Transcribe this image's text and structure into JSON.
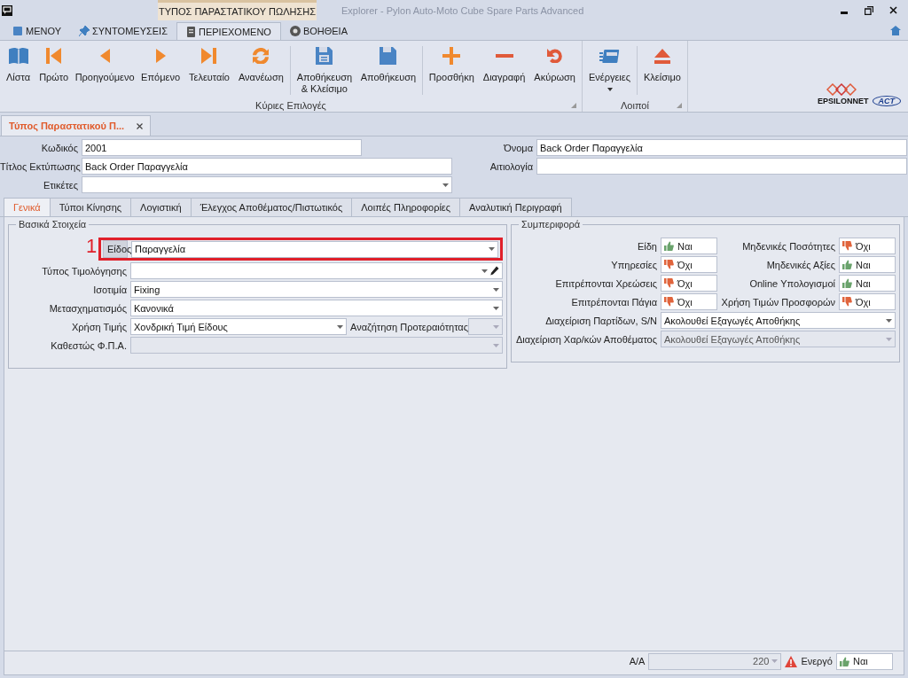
{
  "window": {
    "context_tab": "ΤΥΠΟΣ ΠΑΡΑΣΤΑΤΙΚΟΥ ΠΩΛΗΣΗΣ",
    "title": "Explorer - Pylon Auto-Moto Cube Spare Parts Advanced"
  },
  "ribbon_tabs": [
    {
      "label": "ΜΕΝΟΥ",
      "selected": false
    },
    {
      "label": "ΣΥΝΤΟΜΕΥΣΕΙΣ",
      "selected": false
    },
    {
      "label": "ΠΕΡΙΕΧΟΜΕΝΟ",
      "selected": true
    },
    {
      "label": "ΒΟΗΘΕΙΑ",
      "selected": false
    }
  ],
  "ribbon_groups": [
    {
      "label": "Κύριες Επιλογές",
      "sets": [
        [
          {
            "label": "Λίστα"
          },
          {
            "label": "Πρώτο"
          },
          {
            "label": "Προηγούμενο"
          },
          {
            "label": "Επόμενο"
          },
          {
            "label": "Τελευταίο"
          },
          {
            "label": "Ανανέωση"
          }
        ],
        [
          {
            "label": "Αποθήκευση & Κλείσιμο"
          },
          {
            "label": "Αποθήκευση"
          }
        ],
        [
          {
            "label": "Προσθήκη"
          },
          {
            "label": "Διαγραφή"
          },
          {
            "label": "Ακύρωση"
          }
        ]
      ]
    },
    {
      "label": "Λοιποί",
      "sets": [
        [
          {
            "label": "Ενέργειες",
            "dropdown": true
          }
        ],
        [
          {
            "label": "Κλείσιμο"
          }
        ]
      ]
    }
  ],
  "logo": {
    "brand": "EPSILONNET",
    "partner": "ACT"
  },
  "document_tabs": [
    {
      "label": "Τύπος Παραστατικού Π...",
      "selected": true
    }
  ],
  "header_fields": [
    {
      "label": "Κωδικός",
      "kind": "text",
      "value": "2001"
    },
    {
      "label": "Όνομα",
      "kind": "text",
      "value": "Back Order Παραγγελία"
    },
    {
      "label": "Τίτλος Εκτύπωσης",
      "kind": "text",
      "value": "Back Order Παραγγελία"
    },
    {
      "label": "Αιτιολογία",
      "kind": "text"
    },
    {
      "label": "Ετικέτες",
      "kind": "combo"
    }
  ],
  "form_tabs": [
    {
      "label": "Γενικά",
      "selected": true
    },
    {
      "label": "Τύποι Κίνησης",
      "selected": false
    },
    {
      "label": "Λογιστική",
      "selected": false
    },
    {
      "label": "Έλεγχος Αποθέματος/Πιστωτικός",
      "selected": false
    },
    {
      "label": "Λοιπές Πληροφορίες",
      "selected": false
    },
    {
      "label": "Αναλυτική Περιγραφή",
      "selected": false
    }
  ],
  "basic": {
    "title": "Βασικά Στοιχεία",
    "rows": [
      {
        "label": "Είδος",
        "kind": "combo",
        "value": "Παραγγελία",
        "disabled": false,
        "callout": "1"
      },
      {
        "label": "Τύπος Τιμολόγησης",
        "kind": "lookup",
        "disabled": false
      },
      {
        "label": "Ισοτιμία",
        "kind": "combo",
        "value": "Fixing",
        "disabled": false
      },
      {
        "label": "Μετασχηματισμός",
        "kind": "combo",
        "value": "Κανονικά",
        "disabled": false
      },
      {
        "label": "Χρήση Τιμής",
        "kind": "combo",
        "value": "Χονδρική Τιμή Είδους",
        "disabled": false,
        "extra": {
          "label": "Αναζήτηση Προτεραιότητας",
          "kind": "combo",
          "disabled": true
        }
      },
      {
        "label": "Καθεστώς Φ.Π.Α.",
        "kind": "combo",
        "disabled": true
      }
    ]
  },
  "behavior": {
    "title": "Συμπεριφορά",
    "toggles": [
      {
        "label": "Είδη",
        "value": "Ναι",
        "on": true
      },
      {
        "label": "Μηδενικές Ποσότητες",
        "value": "Όχι",
        "on": false
      },
      {
        "label": "Υπηρεσίες",
        "value": "Όχι",
        "on": false
      },
      {
        "label": "Μηδενικές Αξίες",
        "value": "Ναι",
        "on": true
      },
      {
        "label": "Επιτρέπονται Χρεώσεις",
        "value": "Όχι",
        "on": false
      },
      {
        "label": "Online Υπολογισμοί",
        "value": "Ναι",
        "on": true
      },
      {
        "label": "Επιτρέπονται Πάγια",
        "value": "Όχι",
        "on": false
      },
      {
        "label": "Χρήση Τιμών Προσφορών",
        "value": "Όχι",
        "on": false
      }
    ],
    "selects": [
      {
        "label": "Διαχείριση Παρτίδων, S/N",
        "kind": "combo",
        "value": "Ακολουθεί Εξαγωγές Αποθήκης",
        "disabled": false
      },
      {
        "label": "Διαχείριση Χαρ/κών Αποθέματος",
        "kind": "combo",
        "value": "Ακολουθεί Εξαγωγές Αποθήκης",
        "disabled": true
      }
    ]
  },
  "status_bar": {
    "number_label": "Α/Α",
    "number": "220",
    "warning": true,
    "active_label": "Ενεργό",
    "active": {
      "value": "Ναι",
      "on": true
    }
  }
}
